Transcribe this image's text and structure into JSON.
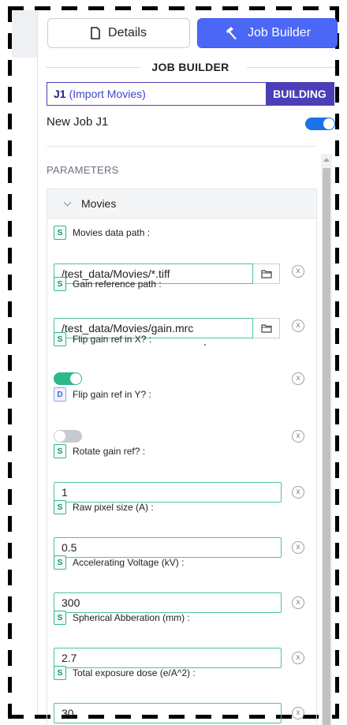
{
  "tabs": {
    "details_label": "Details",
    "builder_label": "Job Builder"
  },
  "section_title": "JOB BUILDER",
  "job": {
    "id": "J1",
    "description": "(Import Movies)",
    "status": "BUILDING"
  },
  "new_job": {
    "label": "New Job J1",
    "enabled": true
  },
  "params_heading": "PARAMETERS",
  "group": {
    "title": "Movies",
    "expanded": true
  },
  "params": [
    {
      "badge": "S",
      "label": "Movies data path :",
      "kind": "path",
      "value": "/test_data/Movies/*.tiff"
    },
    {
      "badge": "S",
      "label": "Gain reference path :",
      "kind": "path",
      "value": "/test_data/Movies/gain.mrc"
    },
    {
      "badge": "S",
      "label": "Flip gain ref in X? :",
      "kind": "toggle",
      "value": true
    },
    {
      "badge": "D",
      "label": "Flip gain ref in Y? :",
      "kind": "toggle",
      "value": false
    },
    {
      "badge": "S",
      "label": "Rotate gain ref? :",
      "kind": "text",
      "value": "1"
    },
    {
      "badge": "S",
      "label": "Raw pixel size (A) :",
      "kind": "text",
      "value": "0.5"
    },
    {
      "badge": "S",
      "label": "Accelerating Voltage (kV) :",
      "kind": "text",
      "value": "300"
    },
    {
      "badge": "S",
      "label": "Spherical Abberation (mm) :",
      "kind": "text",
      "value": "2.7"
    },
    {
      "badge": "S",
      "label": "Total exposure dose (e/A^2) :",
      "kind": "text",
      "value": "30"
    }
  ],
  "clear_glyph": "x",
  "colors": {
    "accent": "#4a67f5",
    "job_border": "#4b3fb7",
    "field_border": "#4fc495",
    "toggle_on": "#2eb886"
  }
}
